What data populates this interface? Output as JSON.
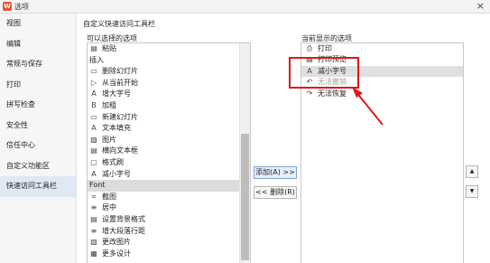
{
  "window": {
    "title": "选项",
    "logo": "W",
    "close_glyph": "×"
  },
  "sidebar": {
    "items": [
      {
        "label": "视图",
        "active": false
      },
      {
        "label": "编辑",
        "active": false
      },
      {
        "label": "常规与保存",
        "active": false
      },
      {
        "label": "打印",
        "active": false
      },
      {
        "label": "拼写检查",
        "active": false
      },
      {
        "label": "安全性",
        "active": false
      },
      {
        "label": "信任中心",
        "active": false
      },
      {
        "label": "自定义功能区",
        "active": false
      },
      {
        "label": "快速访问工具栏",
        "active": true
      }
    ]
  },
  "main": {
    "section_title": "自定义快速访问工具栏",
    "left_caption": "可以选择的选项",
    "right_caption": "当前显示的选项",
    "available_commands": [
      {
        "icon": "paste-icon",
        "glyph": "▤",
        "label": "粘贴"
      },
      {
        "icon": "none",
        "glyph": "",
        "label": "插入",
        "heading": true
      },
      {
        "icon": "delete-slide-icon",
        "glyph": "▭",
        "label": "删除幻灯片"
      },
      {
        "icon": "play-from-current-icon",
        "glyph": "▷",
        "label": "从当前开始"
      },
      {
        "icon": "increase-font-icon",
        "glyph": "A",
        "label": "增大字号"
      },
      {
        "icon": "bold-icon",
        "glyph": "B",
        "label": "加粗"
      },
      {
        "icon": "new-slide-icon",
        "glyph": "▭",
        "label": "新建幻灯片"
      },
      {
        "icon": "text-fill-icon",
        "glyph": "A",
        "label": "文本填充"
      },
      {
        "icon": "picture-icon",
        "glyph": "▨",
        "label": "图片"
      },
      {
        "icon": "horizontal-textbox-icon",
        "glyph": "▤",
        "label": "横向文本框"
      },
      {
        "icon": "shape-icon",
        "glyph": "▢",
        "label": "格式刷"
      },
      {
        "icon": "decrease-font-icon",
        "glyph": "A",
        "label": "减小字号"
      },
      {
        "icon": "none",
        "glyph": "",
        "label": "Font",
        "heading": true,
        "selected": true
      },
      {
        "icon": "screenshot-icon",
        "glyph": "⌗",
        "label": "截图"
      },
      {
        "icon": "center-icon",
        "glyph": "≡",
        "label": "居中"
      },
      {
        "icon": "background-format-icon",
        "glyph": "▤",
        "label": "设置背景格式"
      },
      {
        "icon": "line-spacing-icon",
        "glyph": "≡",
        "label": "增大段落行距"
      },
      {
        "icon": "change-picture-icon",
        "glyph": "▨",
        "label": "更改图片"
      },
      {
        "icon": "more-design-icon",
        "glyph": "▦",
        "label": "更多设计"
      }
    ],
    "current_commands": [
      {
        "icon": "print-icon",
        "glyph": "⎙",
        "label": "打印",
        "state": "normal"
      },
      {
        "icon": "print-preview-icon",
        "glyph": "▤",
        "label": "打印预览",
        "state": "normal"
      },
      {
        "icon": "decrease-font-icon",
        "glyph": "A",
        "label": "减小字号",
        "state": "selected"
      },
      {
        "icon": "undo-icon",
        "glyph": "↶",
        "label": "无法撤销",
        "state": "disabled"
      },
      {
        "icon": "redo-icon",
        "glyph": "↷",
        "label": "无法恢复",
        "state": "normal"
      }
    ],
    "add_button": "添加(A) >>",
    "remove_button": "<< 删除(R)",
    "move_up_glyph": "▲",
    "move_down_glyph": "▼"
  },
  "colors": {
    "annotation": "#e01818",
    "selected_row": "#dcdcdc",
    "sidebar_active": "#dfe8f5"
  }
}
